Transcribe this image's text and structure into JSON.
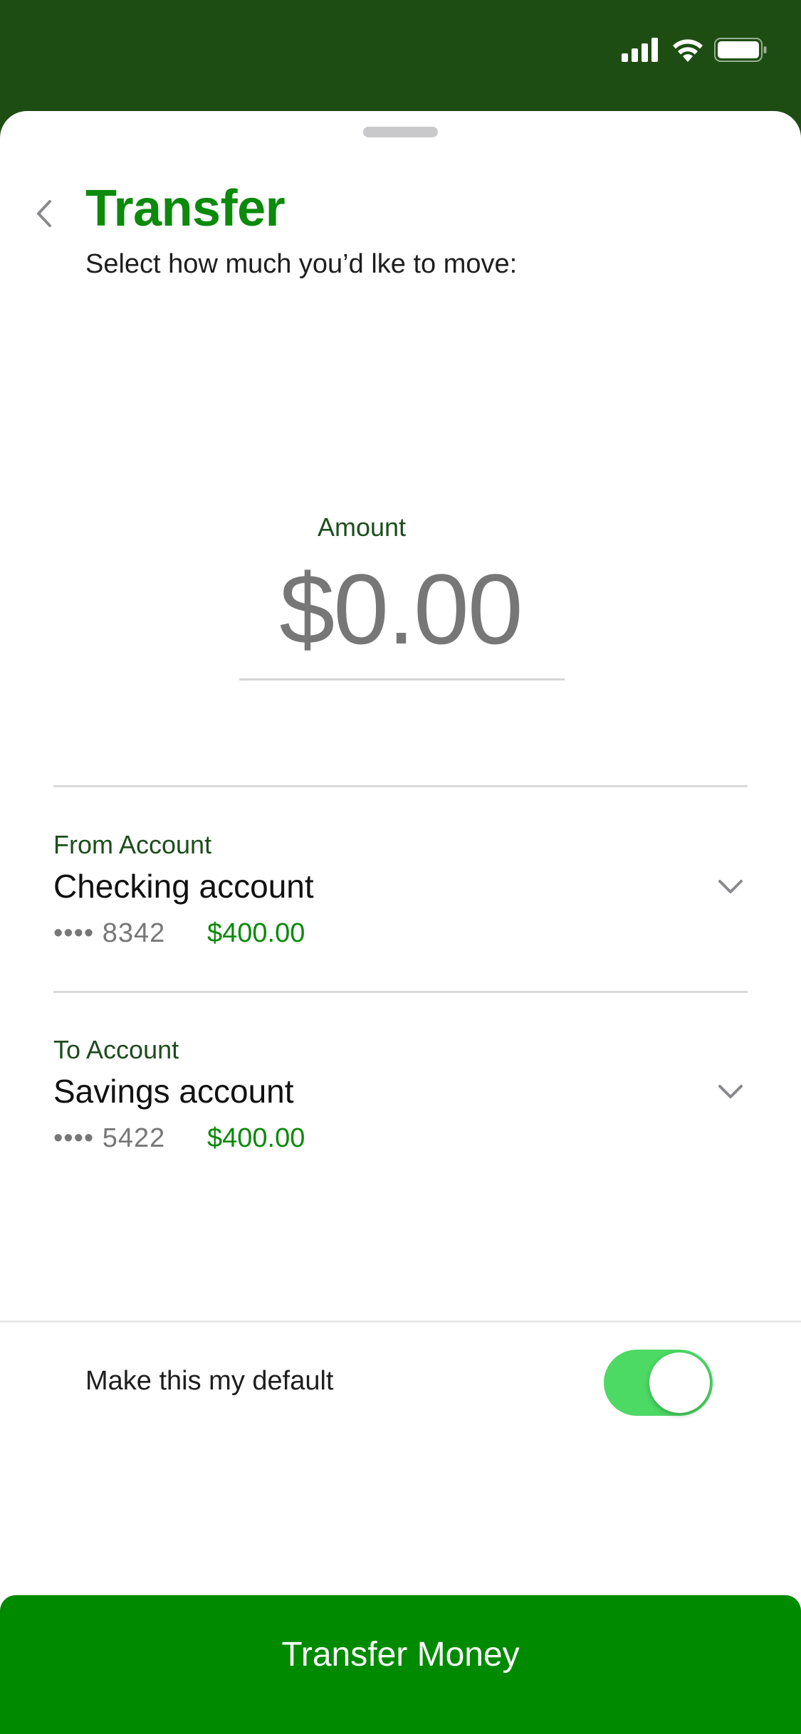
{
  "status_bar": {
    "signal_icon": "cellular-signal-icon",
    "wifi_icon": "wifi-icon",
    "battery_icon": "battery-icon"
  },
  "header": {
    "back_icon": "chevron-left-icon",
    "title": "Transfer",
    "subtitle": "Select how much you’d lke to move:"
  },
  "amount": {
    "label": "Amount",
    "value": "$0.00"
  },
  "from_account": {
    "caption": "From Account",
    "name": "Checking account",
    "mask": "•••• 8342",
    "balance": "$400.00",
    "chevron_icon": "chevron-down-icon"
  },
  "to_account": {
    "caption": "To Account",
    "name": "Savings account",
    "mask": "•••• 5422",
    "balance": "$400.00",
    "chevron_icon": "chevron-down-icon"
  },
  "default_setting": {
    "label": "Make this my default",
    "enabled": true
  },
  "primary_action": {
    "label": "Transfer Money"
  },
  "colors": {
    "status_bar_bg": "#1d4d12",
    "title_green": "#0b8a0b",
    "caption_green": "#1d4d1d",
    "toggle_on": "#4cd964",
    "button_green": "#008a00"
  }
}
